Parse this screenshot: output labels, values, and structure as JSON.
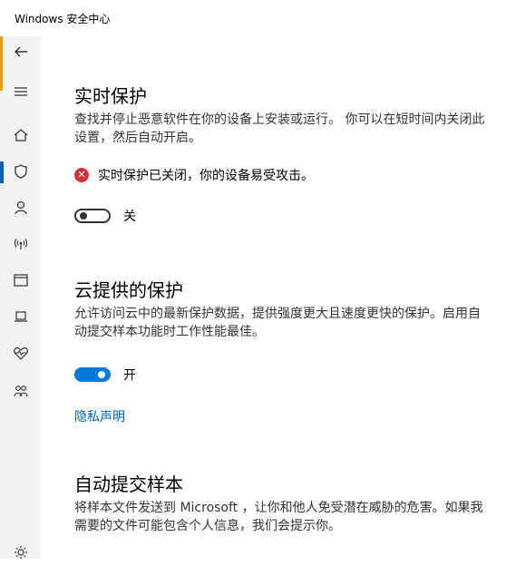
{
  "window": {
    "title": "Windows 安全中心"
  },
  "colors": {
    "accent": "#0078d7",
    "error": "#d13438",
    "link": "#0063b1"
  },
  "nav": {
    "back_icon": "back-arrow-icon",
    "items": [
      {
        "name": "menu",
        "icon": "hamburger-icon",
        "selected": false
      },
      {
        "name": "home",
        "icon": "home-icon",
        "selected": false
      },
      {
        "name": "virus-protection",
        "icon": "shield-icon",
        "selected": true
      },
      {
        "name": "account-protection",
        "icon": "person-icon",
        "selected": false
      },
      {
        "name": "firewall-network",
        "icon": "wireless-icon",
        "selected": false
      },
      {
        "name": "app-browser-control",
        "icon": "browser-window-icon",
        "selected": false
      },
      {
        "name": "device-security",
        "icon": "laptop-icon",
        "selected": false
      },
      {
        "name": "device-performance-health",
        "icon": "heart-pulse-icon",
        "selected": false
      },
      {
        "name": "family-options",
        "icon": "family-icon",
        "selected": false
      },
      {
        "name": "settings",
        "icon": "gear-icon",
        "selected": false
      }
    ]
  },
  "realtime": {
    "title": "实时保护",
    "desc_line1": "查找并停止恶意软件在你的设备上安装或运行。 你可以在短时间内关闭此",
    "desc_line2": "设置，然后自动开启。",
    "status_text": "实时保护已关闭，你的设备易受攻击。",
    "toggle_state": "关",
    "toggle_on": false
  },
  "cloud": {
    "title": "云提供的保护",
    "desc_line1": "允许访问云中的最新保护数据，提供强度更大且速度更快的保护。启用自",
    "desc_line2": "动提交样本功能时工作性能最佳。",
    "toggle_state": "开",
    "toggle_on": true,
    "privacy_link": "隐私声明"
  },
  "autosubmit": {
    "title": "自动提交样本",
    "desc_line1": "将样本文件发送到 Microsoft ，让你和他人免受潜在威胁的危害。如果我",
    "desc_line2": "需要的文件可能包含个人信息，我们会提示你。"
  }
}
